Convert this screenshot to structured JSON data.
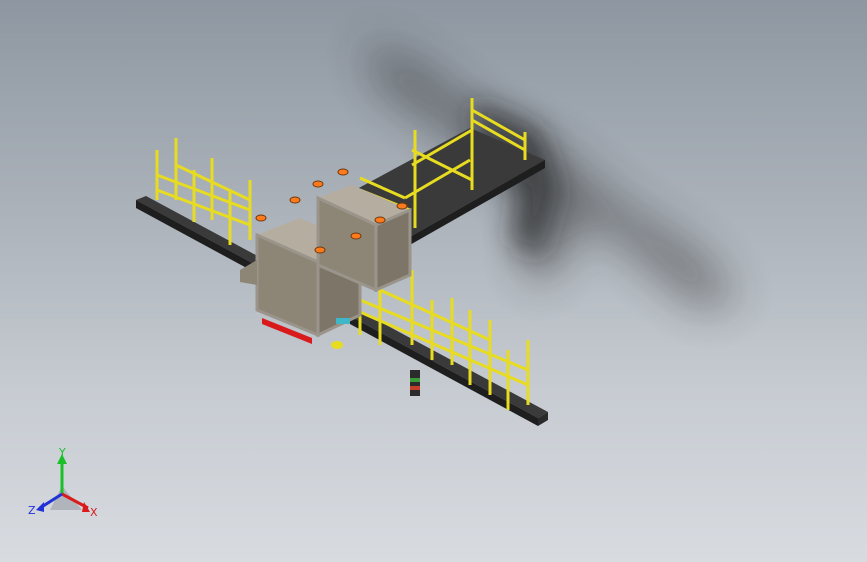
{
  "viewport": {
    "background_top": "#8e97a1",
    "background_bottom": "#d8dbe0"
  },
  "model": {
    "platform_color": "#2b2b2b",
    "railing_color": "#e8dc21",
    "frame_color": "#9a948a",
    "panel_color": "#8d8677",
    "lamp_color": "#ff7a1a",
    "stripe_color": "#d91a1a",
    "accent_color": "#3fb7c9"
  },
  "triad": {
    "x_label": "X",
    "y_label": "Y",
    "z_label": "Z",
    "x_color": "#d81b1b",
    "y_color": "#1bbf2a",
    "z_color": "#2133d6"
  }
}
